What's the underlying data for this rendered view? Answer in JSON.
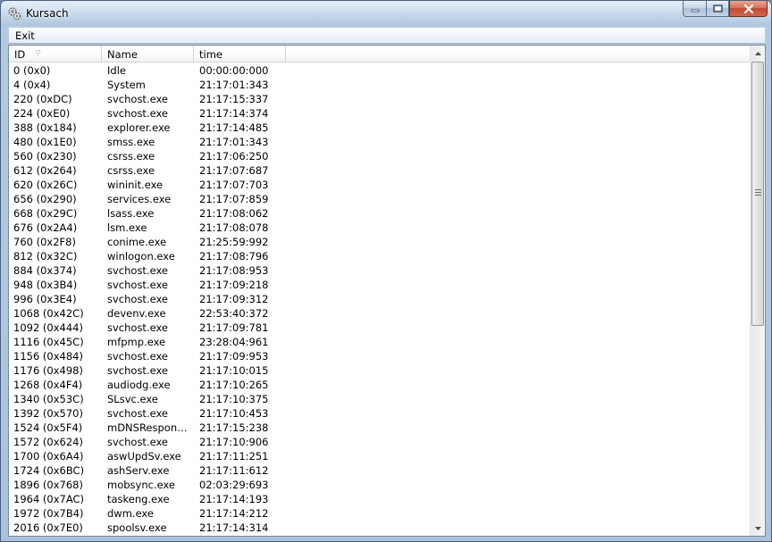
{
  "window": {
    "title": "Kursach"
  },
  "menu": {
    "items": [
      {
        "label": "Exit"
      }
    ]
  },
  "columns": [
    {
      "label": "ID",
      "sort": "descending"
    },
    {
      "label": "Name"
    },
    {
      "label": "time"
    }
  ],
  "rows": [
    {
      "id": "0 (0x0)",
      "name": "Idle",
      "time": "00:00:00:000"
    },
    {
      "id": "4 (0x4)",
      "name": "System",
      "time": "21:17:01:343"
    },
    {
      "id": "220 (0xDC)",
      "name": "svchost.exe",
      "time": "21:17:15:337"
    },
    {
      "id": "224 (0xE0)",
      "name": "svchost.exe",
      "time": "21:17:14:374"
    },
    {
      "id": "388 (0x184)",
      "name": "explorer.exe",
      "time": "21:17:14:485"
    },
    {
      "id": "480 (0x1E0)",
      "name": "smss.exe",
      "time": "21:17:01:343"
    },
    {
      "id": "560 (0x230)",
      "name": "csrss.exe",
      "time": "21:17:06:250"
    },
    {
      "id": "612 (0x264)",
      "name": "csrss.exe",
      "time": "21:17:07:687"
    },
    {
      "id": "620 (0x26C)",
      "name": "wininit.exe",
      "time": "21:17:07:703"
    },
    {
      "id": "656 (0x290)",
      "name": "services.exe",
      "time": "21:17:07:859"
    },
    {
      "id": "668 (0x29C)",
      "name": "lsass.exe",
      "time": "21:17:08:062"
    },
    {
      "id": "676 (0x2A4)",
      "name": "lsm.exe",
      "time": "21:17:08:078"
    },
    {
      "id": "760 (0x2F8)",
      "name": "conime.exe",
      "time": "21:25:59:992"
    },
    {
      "id": "812 (0x32C)",
      "name": "winlogon.exe",
      "time": "21:17:08:796"
    },
    {
      "id": "884 (0x374)",
      "name": "svchost.exe",
      "time": "21:17:08:953"
    },
    {
      "id": "948 (0x3B4)",
      "name": "svchost.exe",
      "time": "21:17:09:218"
    },
    {
      "id": "996 (0x3E4)",
      "name": "svchost.exe",
      "time": "21:17:09:312"
    },
    {
      "id": "1068 (0x42C)",
      "name": "devenv.exe",
      "time": "22:53:40:372"
    },
    {
      "id": "1092 (0x444)",
      "name": "svchost.exe",
      "time": "21:17:09:781"
    },
    {
      "id": "1116 (0x45C)",
      "name": "mfpmp.exe",
      "time": "23:28:04:961"
    },
    {
      "id": "1156 (0x484)",
      "name": "svchost.exe",
      "time": "21:17:09:953"
    },
    {
      "id": "1176 (0x498)",
      "name": "svchost.exe",
      "time": "21:17:10:015"
    },
    {
      "id": "1268 (0x4F4)",
      "name": "audiodg.exe",
      "time": "21:17:10:265"
    },
    {
      "id": "1340 (0x53C)",
      "name": "SLsvc.exe",
      "time": "21:17:10:375"
    },
    {
      "id": "1392 (0x570)",
      "name": "svchost.exe",
      "time": "21:17:10:453"
    },
    {
      "id": "1524 (0x5F4)",
      "name": "mDNSRespond...",
      "time": "21:17:15:238"
    },
    {
      "id": "1572 (0x624)",
      "name": "svchost.exe",
      "time": "21:17:10:906"
    },
    {
      "id": "1700 (0x6A4)",
      "name": "aswUpdSv.exe",
      "time": "21:17:11:251"
    },
    {
      "id": "1724 (0x6BC)",
      "name": "ashServ.exe",
      "time": "21:17:11:612"
    },
    {
      "id": "1896 (0x768)",
      "name": "mobsync.exe",
      "time": "02:03:29:693"
    },
    {
      "id": "1964 (0x7AC)",
      "name": "taskeng.exe",
      "time": "21:17:14:193"
    },
    {
      "id": "1972 (0x7B4)",
      "name": "dwm.exe",
      "time": "21:17:14:212"
    },
    {
      "id": "2016 (0x7E0)",
      "name": "spoolsv.exe",
      "time": "21:17:14:314"
    }
  ],
  "icons": {
    "app": "gears-icon",
    "minimize": "minimize-icon",
    "maximize": "maximize-icon",
    "close": "close-icon",
    "sort": "sort-descending-icon",
    "scroll_up": "scroll-up-icon",
    "scroll_down": "scroll-down-icon"
  },
  "colors": {
    "close_button": "#c14a32",
    "header_bg": "#ffffff",
    "list_bg": "#ffffff"
  }
}
